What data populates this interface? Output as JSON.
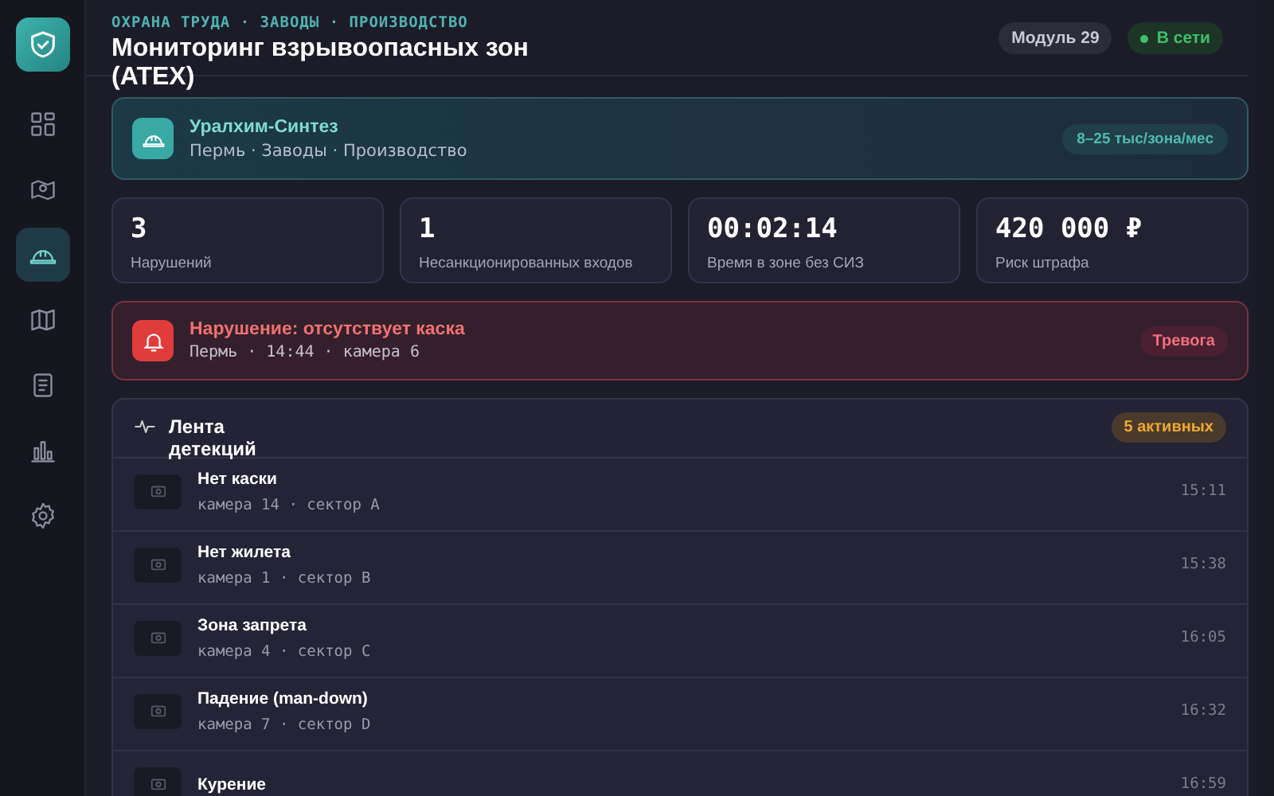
{
  "sidebar": {
    "items": [
      {
        "selected": false
      },
      {
        "selected": false
      },
      {
        "selected": true
      },
      {
        "selected": false
      },
      {
        "selected": false
      },
      {
        "selected": false
      },
      {
        "selected": false
      }
    ]
  },
  "header": {
    "breadcrumb": "ОХРАНА ТРУДА · ЗАВОДЫ · ПРОИЗВОДСТВО",
    "title": "Мониторинг взрывоопасных зон (ATEX)",
    "module": "Модуль 29",
    "status": {
      "label": "В сети",
      "color": "#3fbf6a"
    }
  },
  "org": {
    "name": "Уралхим-Синтез",
    "meta": "Пермь · Заводы · Производство",
    "price": "8–25 тыс/зона/мес"
  },
  "stats": [
    {
      "value": "3",
      "label": "Нарушений"
    },
    {
      "value": "1",
      "label": "Несанкционированных входов"
    },
    {
      "value": "00:02:14",
      "label": "Время в зоне без СИЗ"
    },
    {
      "value": "420 000 ₽",
      "label": "Риск штрафа"
    }
  ],
  "alert": {
    "title": "Нарушение: отсутствует каска",
    "meta": "Пермь · 14:44 · камера 6",
    "badge": "Тревога"
  },
  "feed": {
    "title": "Лента детекций",
    "badge": "5 активных",
    "rows": [
      {
        "title": "Нет каски",
        "meta": "камера 14 · сектор A",
        "time": "15:11"
      },
      {
        "title": "Нет жилета",
        "meta": "камера 1 · сектор B",
        "time": "15:38"
      },
      {
        "title": "Зона запрета",
        "meta": "камера 4 · сектор C",
        "time": "16:05"
      },
      {
        "title": "Падение (man-down)",
        "meta": "камера 7 · сектор D",
        "time": "16:32"
      },
      {
        "title": "Курение",
        "time": "16:59"
      }
    ]
  }
}
